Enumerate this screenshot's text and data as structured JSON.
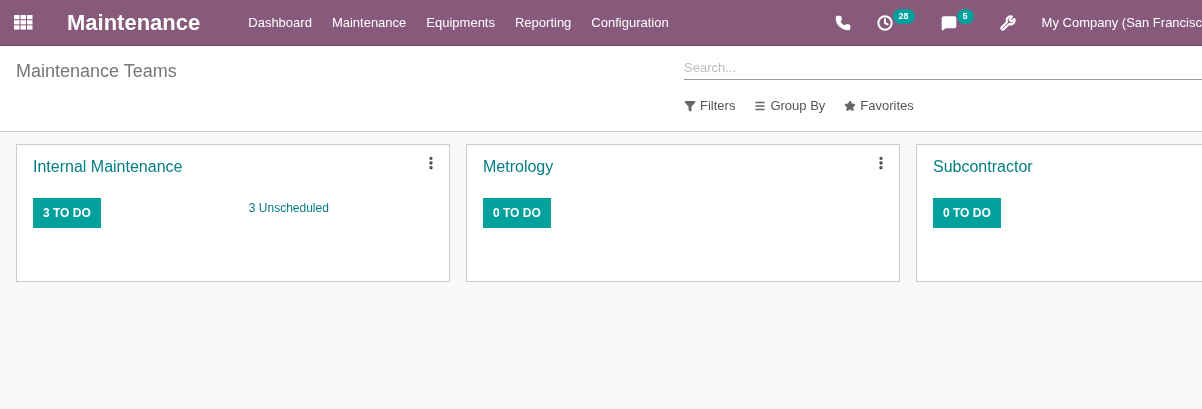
{
  "navbar": {
    "app_title": "Maintenance",
    "menu": [
      "Dashboard",
      "Maintenance",
      "Equipments",
      "Reporting",
      "Configuration"
    ],
    "systray": [
      {
        "kind": "phone"
      },
      {
        "kind": "activity",
        "badge": "28"
      },
      {
        "kind": "chat",
        "badge": "5"
      },
      {
        "kind": "tools"
      }
    ],
    "company": "My Company (San Francisc"
  },
  "control_panel": {
    "breadcrumb": "Maintenance Teams",
    "search": {
      "placeholder": "Search..."
    },
    "filters": [
      {
        "kind": "filter",
        "label": "Filters"
      },
      {
        "kind": "group",
        "label": "Group By"
      },
      {
        "kind": "star",
        "label": "Favorites"
      }
    ]
  },
  "teams": [
    {
      "name": "Internal Maintenance",
      "todo": "3 TO DO",
      "unscheduled": "3 Unscheduled",
      "menu": true
    },
    {
      "name": "Metrology",
      "todo": "0 TO DO",
      "menu": true
    },
    {
      "name": "Subcontractor",
      "todo": "0 TO DO",
      "menu": false
    }
  ]
}
